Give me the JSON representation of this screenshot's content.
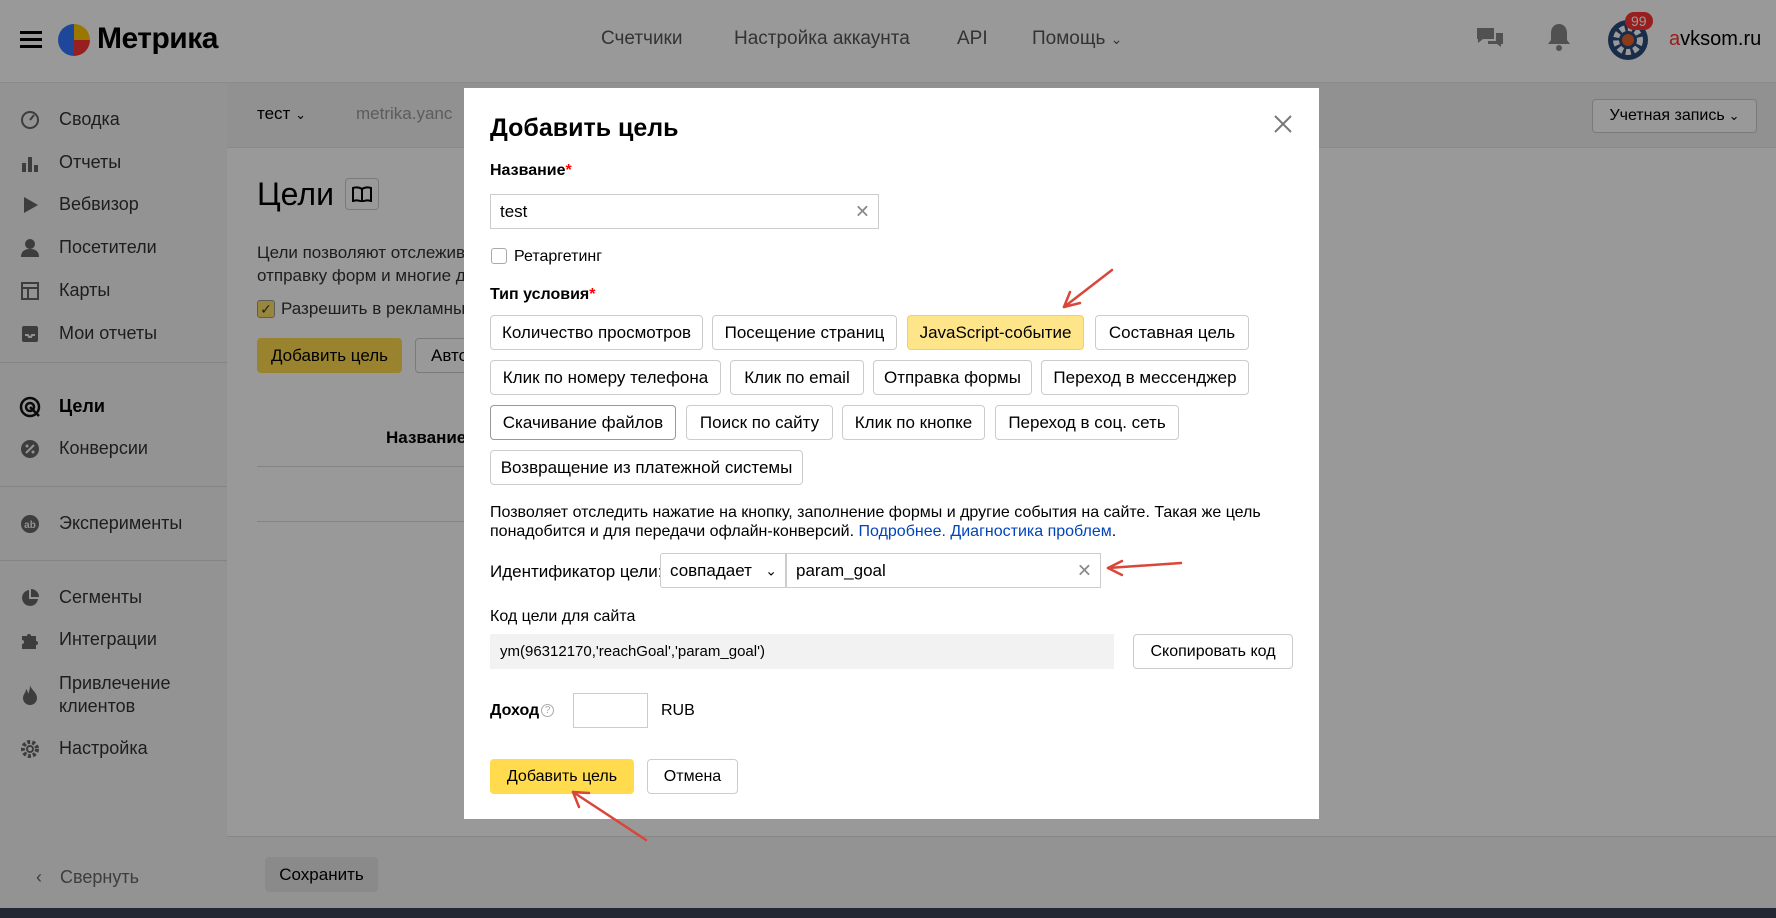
{
  "app": {
    "logo": "Метрика",
    "nav": [
      "Счетчики",
      "Настройка аккаунта",
      "API",
      "Помощь"
    ],
    "notifications_badge": "99",
    "user_first_letter": "a",
    "user_rest": "vksom.ru"
  },
  "sidebar": {
    "items": [
      {
        "label": "Сводка",
        "icon": "gauge-icon"
      },
      {
        "label": "Отчеты",
        "icon": "bar-chart-icon"
      },
      {
        "label": "Вебвизор",
        "icon": "play-icon"
      },
      {
        "label": "Посетители",
        "icon": "user-icon"
      },
      {
        "label": "Карты",
        "icon": "map-icon"
      },
      {
        "label": "Мои отчеты",
        "icon": "inbox-icon"
      },
      {
        "label": "Цели",
        "icon": "target-icon"
      },
      {
        "label": "Конверсии",
        "icon": "percent-icon"
      },
      {
        "label": "Эксперименты",
        "icon": "ab-icon"
      },
      {
        "label": "Сегменты",
        "icon": "pie-icon"
      },
      {
        "label": "Интеграции",
        "icon": "puzzle-icon"
      },
      {
        "label": "Привлечение клиентов",
        "icon": "flame-icon"
      },
      {
        "label": "Настройка",
        "icon": "gear-icon"
      }
    ],
    "collapse": "Свернуть"
  },
  "page": {
    "counter": "тест",
    "site": "metrika.yanc",
    "account_button": "Учетная запись",
    "title": "Цели",
    "desc_line1": "Цели позволяют отслежива",
    "desc_line2": "отправку форм и многие др",
    "allow_label": "Разрешить в рекламных",
    "add_goal_button": "Добавить цель",
    "auto_button": "Авто",
    "table_header": "Название",
    "save_button": "Сохранить"
  },
  "modal": {
    "title": "Добавить цель",
    "name_label": "Название",
    "name_value": "test",
    "retargeting_label": "Ретаргетинг",
    "condition_type_label": "Тип условия",
    "condition_types": [
      "Количество просмотров",
      "Посещение страниц",
      "JavaScript-событие",
      "Составная цель",
      "Клик по номеру телефона",
      "Клик по email",
      "Отправка формы",
      "Переход в мессенджер",
      "Скачивание файлов",
      "Поиск по сайту",
      "Клик по кнопке",
      "Переход в соц. сеть",
      "Возвращение из платежной системы"
    ],
    "selected_condition": "JavaScript-событие",
    "description": "Позволяет отследить нажатие на кнопку, заполнение формы и другие события на сайте. Такая же цель понадобится и для передачи офлайн-конверсий.",
    "more_link": "Подробнее.",
    "diagnostics_link": "Диагностика проблем",
    "identifier_label": "Идентификатор цели:",
    "match_select": "совпадает",
    "identifier_value": "param_goal",
    "code_label": "Код цели для сайта",
    "code_value": "ym(96312170,'reachGoal','param_goal')",
    "copy_button": "Скопировать код",
    "income_label": "Доход",
    "currency": "RUB",
    "submit_button": "Добавить цель",
    "cancel_button": "Отмена"
  },
  "colors": {
    "accent": "#ffdb4d",
    "selected_chip": "#ffe58a",
    "link": "#0044bb",
    "arrow": "#d9463a"
  }
}
